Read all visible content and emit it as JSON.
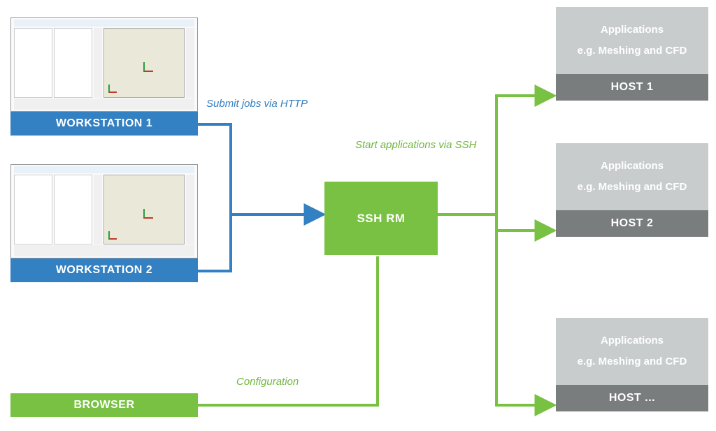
{
  "workstations": [
    {
      "label": "WORKSTATION 1"
    },
    {
      "label": "WORKSTATION 2"
    }
  ],
  "browser": {
    "label": "BROWSER"
  },
  "sshrm": {
    "label": "SSH RM"
  },
  "hosts": [
    {
      "apps": "Applications",
      "example": "e.g. Meshing and CFD",
      "label": "HOST 1"
    },
    {
      "apps": "Applications",
      "example": "e.g. Meshing and CFD",
      "label": "HOST 2"
    },
    {
      "apps": "Applications",
      "example": "e.g. Meshing and CFD",
      "label": "HOST ..."
    }
  ],
  "annotations": {
    "submit": "Submit jobs via HTTP",
    "start": "Start applications via SSH",
    "config": "Configuration"
  },
  "chart_data": {
    "type": "diagram",
    "nodes": [
      {
        "id": "ws1",
        "label": "WORKSTATION 1",
        "kind": "workstation"
      },
      {
        "id": "ws2",
        "label": "WORKSTATION 2",
        "kind": "workstation"
      },
      {
        "id": "browser",
        "label": "BROWSER",
        "kind": "browser"
      },
      {
        "id": "sshrm",
        "label": "SSH RM",
        "kind": "resource-manager"
      },
      {
        "id": "host1",
        "label": "HOST 1",
        "kind": "host",
        "note": "Applications e.g. Meshing and CFD"
      },
      {
        "id": "host2",
        "label": "HOST 2",
        "kind": "host",
        "note": "Applications e.g. Meshing and CFD"
      },
      {
        "id": "host3",
        "label": "HOST ...",
        "kind": "host",
        "note": "Applications e.g. Meshing and CFD"
      }
    ],
    "edges": [
      {
        "from": "ws1",
        "to": "sshrm",
        "label": "Submit jobs via HTTP",
        "protocol": "HTTP"
      },
      {
        "from": "ws2",
        "to": "sshrm",
        "label": "Submit jobs via HTTP",
        "protocol": "HTTP"
      },
      {
        "from": "browser",
        "to": "sshrm",
        "label": "Configuration"
      },
      {
        "from": "sshrm",
        "to": "host1",
        "label": "Start applications via SSH",
        "protocol": "SSH"
      },
      {
        "from": "sshrm",
        "to": "host2",
        "label": "Start applications via SSH",
        "protocol": "SSH"
      },
      {
        "from": "sshrm",
        "to": "host3",
        "label": "Start applications via SSH",
        "protocol": "SSH"
      }
    ]
  }
}
